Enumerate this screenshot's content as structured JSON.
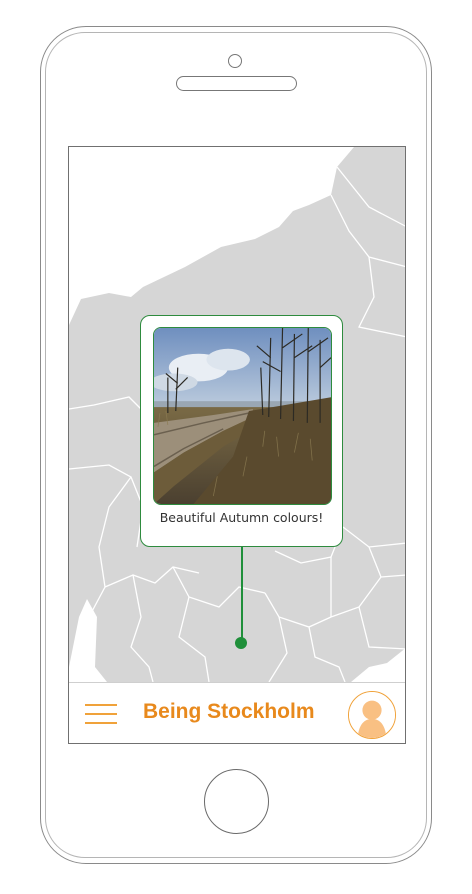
{
  "device": {
    "frame": "smartphone outline"
  },
  "map": {
    "land_color": "#d6d6d6",
    "border_color": "#ffffff"
  },
  "popup": {
    "caption": "Beautiful Autumn colours!",
    "accent_color": "#2e8b3e",
    "photo_icon": "lakeside-boardwalk-photo"
  },
  "app_bar": {
    "menu_icon": "hamburger-menu-icon",
    "title": "Being Stockholm",
    "title_color": "#e8891c",
    "avatar_icon": "user-avatar-icon",
    "accent_color": "#f0a23a"
  }
}
